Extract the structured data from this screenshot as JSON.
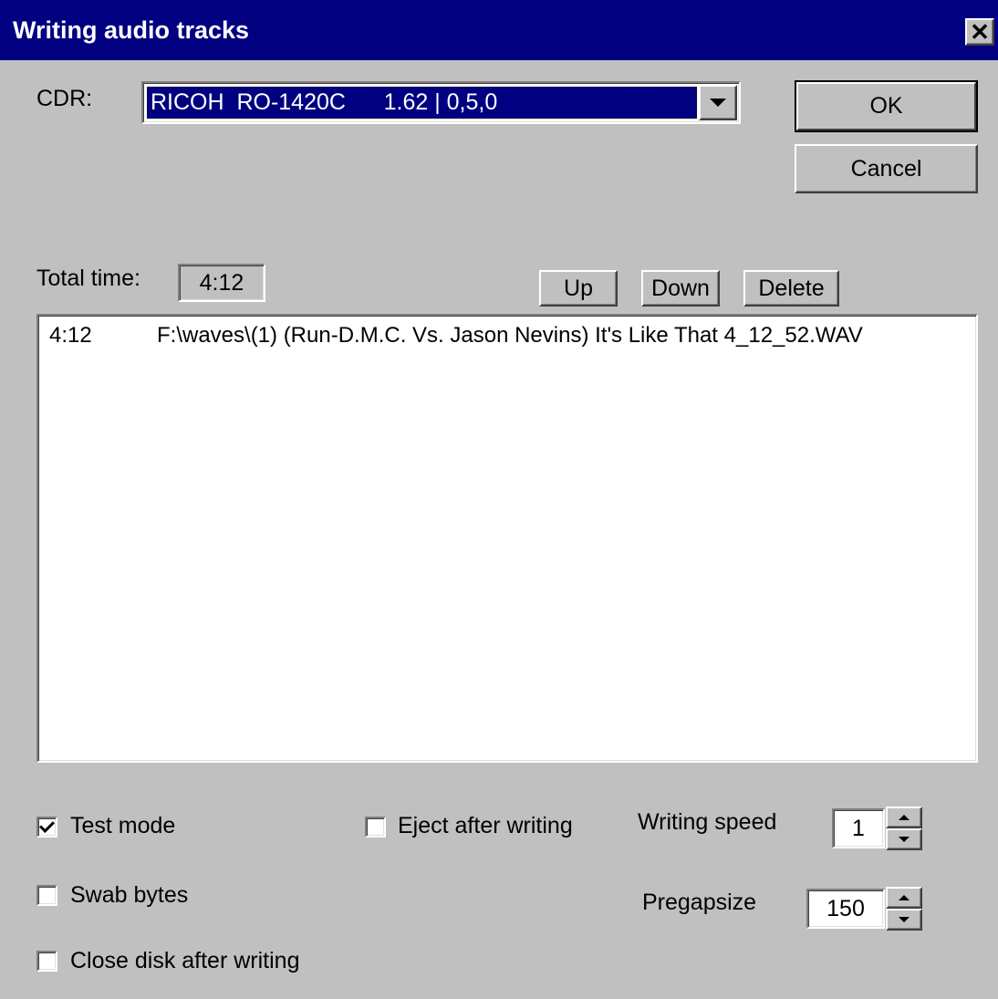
{
  "window": {
    "title": "Writing audio tracks",
    "close_glyph": "✕"
  },
  "cdr": {
    "label": "CDR:",
    "selected": "RICOH  RO-1420C      1.62 | 0,5,0"
  },
  "buttons": {
    "ok": "OK",
    "cancel": "Cancel",
    "up": "Up",
    "down": "Down",
    "delete": "Delete"
  },
  "total_time": {
    "label": "Total time:",
    "value": "4:12"
  },
  "tracks": [
    {
      "time": "4:12",
      "file": "F:\\waves\\(1) (Run-D.M.C. Vs. Jason Nevins) It's Like That  4_12_52.WAV"
    }
  ],
  "options": {
    "test_mode": {
      "label": "Test mode",
      "checked": true
    },
    "swab_bytes": {
      "label": "Swab bytes",
      "checked": false
    },
    "close_disk": {
      "label": "Close disk after writing",
      "checked": false
    },
    "eject_after": {
      "label": "Eject after writing",
      "checked": false
    }
  },
  "writing_speed": {
    "label": "Writing speed",
    "value": "1"
  },
  "pregapsize": {
    "label": "Pregapsize",
    "value": "150"
  },
  "colors": {
    "titlebar": "#000080",
    "face": "#c0c0c0",
    "selection": "#000080"
  }
}
